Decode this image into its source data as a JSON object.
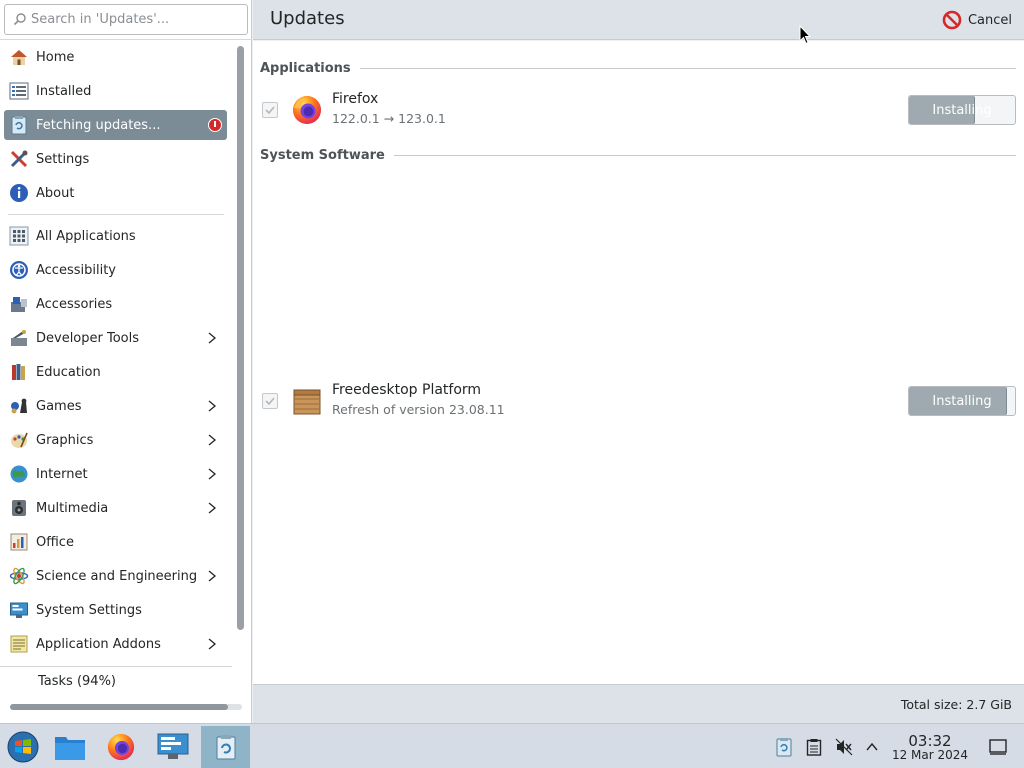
{
  "search": {
    "placeholder": "Search in 'Updates'..."
  },
  "sidebar": {
    "items": [
      {
        "label": "Home",
        "icon": "home-icon"
      },
      {
        "label": "Installed",
        "icon": "installed-list-icon"
      },
      {
        "label": "Fetching updates...",
        "icon": "updates-icon",
        "active": true
      },
      {
        "label": "Settings",
        "icon": "settings-icon"
      },
      {
        "label": "About",
        "icon": "about-info-icon"
      }
    ],
    "categories": [
      {
        "label": "All Applications",
        "icon": "all-applications-icon",
        "has_children": false
      },
      {
        "label": "Accessibility",
        "icon": "accessibility-icon",
        "has_children": false
      },
      {
        "label": "Accessories",
        "icon": "accessories-icon",
        "has_children": false
      },
      {
        "label": "Developer Tools",
        "icon": "developer-tools-icon",
        "has_children": true
      },
      {
        "label": "Education",
        "icon": "education-icon",
        "has_children": false
      },
      {
        "label": "Games",
        "icon": "games-icon",
        "has_children": true
      },
      {
        "label": "Graphics",
        "icon": "graphics-icon",
        "has_children": true
      },
      {
        "label": "Internet",
        "icon": "internet-icon",
        "has_children": true
      },
      {
        "label": "Multimedia",
        "icon": "multimedia-icon",
        "has_children": true
      },
      {
        "label": "Office",
        "icon": "office-icon",
        "has_children": false
      },
      {
        "label": "Science and Engineering",
        "icon": "science-icon",
        "has_children": true
      },
      {
        "label": "System Settings",
        "icon": "system-settings-icon",
        "has_children": false
      },
      {
        "label": "Application Addons",
        "icon": "addons-icon",
        "has_children": true
      }
    ],
    "tasks_label": "Tasks (94%)",
    "tasks_progress": 0.94
  },
  "header": {
    "title": "Updates",
    "cancel_label": "Cancel"
  },
  "main": {
    "sections": [
      {
        "title": "Applications",
        "items": [
          {
            "name": "Firefox",
            "detail": "122.0.1 → 123.0.1",
            "icon": "firefox-icon",
            "checked": true,
            "action_label": "Installing",
            "progress": 0.62
          }
        ]
      },
      {
        "title": "System Software",
        "items": [
          {
            "name": "Freedesktop Platform",
            "detail": "Refresh of version 23.08.11",
            "icon": "package-box-icon",
            "checked": true,
            "action_label": "Installing",
            "progress": 0.92
          }
        ]
      }
    ]
  },
  "footer": {
    "total_size": "Total size: 2.7 GiB"
  },
  "taskbar": {
    "apps": [
      {
        "icon": "start-menu-icon"
      },
      {
        "icon": "file-manager-icon"
      },
      {
        "icon": "firefox-icon"
      },
      {
        "icon": "system-monitor-icon"
      },
      {
        "icon": "software-center-icon",
        "active": true
      }
    ],
    "tray": [
      "updates-tray-icon",
      "clipboard-icon",
      "volume-muted-icon",
      "tray-expand-icon"
    ],
    "clock_time": "03:32",
    "clock_date": "12 Mar 2024"
  },
  "colors": {
    "accent_active": "#7b8c96",
    "header_bg": "#dde2e8",
    "install_fill": "#9eaab0",
    "alert_red": "#d62828"
  }
}
